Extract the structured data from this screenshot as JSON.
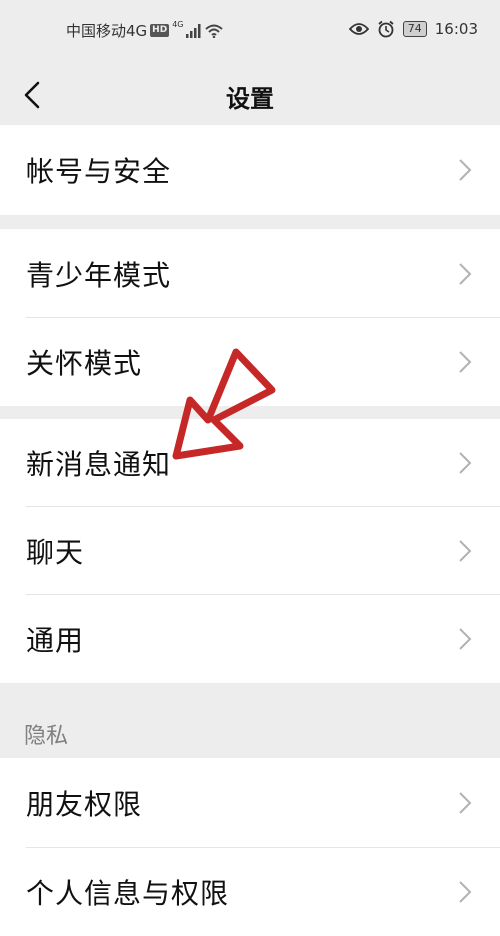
{
  "status_bar": {
    "carrier": "中国移动4G",
    "hd_badge": "HD",
    "network": "4G",
    "battery": "74",
    "time": "16:03"
  },
  "nav": {
    "title": "设置"
  },
  "menu": {
    "account_security": "帐号与安全",
    "teen_mode": "青少年模式",
    "care_mode": "关怀模式",
    "new_message_notification": "新消息通知",
    "chat": "聊天",
    "general": "通用",
    "privacy_section": "隐私",
    "friend_permissions": "朋友权限",
    "personal_info_permissions": "个人信息与权限"
  },
  "colors": {
    "background": "#ededed",
    "cell": "#ffffff",
    "annotation_arrow": "#c62828"
  }
}
